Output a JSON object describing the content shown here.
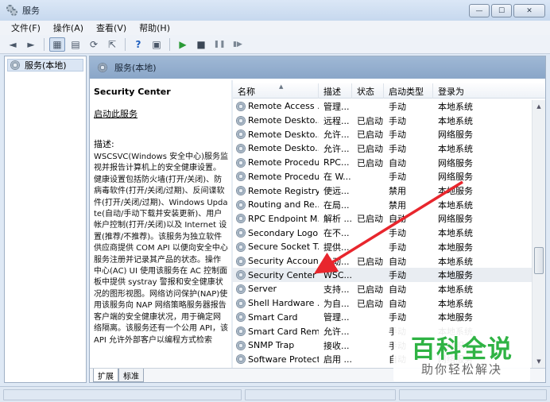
{
  "window": {
    "title": "服务",
    "controls": [
      "—",
      "☐",
      "✕"
    ]
  },
  "menu": [
    "文件(F)",
    "操作(A)",
    "查看(V)",
    "帮助(H)"
  ],
  "toolbar": [
    "◄",
    "►",
    "▦",
    "▤",
    "⟳",
    "⇱",
    "?",
    "▣",
    "▶",
    "■",
    "❚❚",
    "▮▶"
  ],
  "tree": {
    "item": "服务(本地)"
  },
  "header": {
    "title": "服务(本地)"
  },
  "description": {
    "title": "Security Center",
    "start_link": "启动此服务",
    "label": "描述:",
    "body": "WSCSVC(Windows 安全中心)服务监视并报告计算机上的安全健康设置。健康设置包括防火墙(打开/关闭)、防病毒软件(打开/关闭/过期)、反间谍软件(打开/关闭/过期)、Windows Update(自动/手动下载并安装更新)、用户帐户控制(打开/关闭)以及 Internet 设置(推荐/不推荐)。该服务为独立软件供应商提供 COM API 以便向安全中心服务注册并记录其产品的状态。操作中心(AC) UI 使用该服务在 AC 控制面板中提供 systray 警报和安全健康状况的图形视图。网络访问保护(NAP)使用该服务向 NAP 网络策略服务器报告客户端的安全健康状况，用于确定网络隔离。该服务还有一个公用 API，该 API 允许外部客户以编程方式检索"
  },
  "columns": [
    "名称",
    "描述",
    "状态",
    "启动类型",
    "登录为"
  ],
  "rows": [
    [
      "Remote Access ...",
      "管理...",
      "",
      "手动",
      "本地系统"
    ],
    [
      "Remote Deskto...",
      "远程...",
      "已启动",
      "手动",
      "本地系统"
    ],
    [
      "Remote Deskto...",
      "允许...",
      "已启动",
      "手动",
      "网络服务"
    ],
    [
      "Remote Deskto...",
      "允许...",
      "已启动",
      "手动",
      "本地系统"
    ],
    [
      "Remote Procedu...",
      "RPC...",
      "已启动",
      "自动",
      "网络服务"
    ],
    [
      "Remote Procedu...",
      "在 W...",
      "",
      "手动",
      "网络服务"
    ],
    [
      "Remote Registry",
      "使远...",
      "",
      "禁用",
      "本地服务"
    ],
    [
      "Routing and Re...",
      "在局...",
      "",
      "禁用",
      "本地系统"
    ],
    [
      "RPC Endpoint M...",
      "解析 ...",
      "已启动",
      "自动",
      "网络服务"
    ],
    [
      "Secondary Logon",
      "在不...",
      "",
      "手动",
      "本地系统"
    ],
    [
      "Secure Socket T...",
      "提供...",
      "",
      "手动",
      "本地服务"
    ],
    [
      "Security Account...",
      "启动...",
      "已启动",
      "自动",
      "本地系统"
    ],
    [
      "Security Center",
      "WSC...",
      "",
      "手动",
      "本地服务"
    ],
    [
      "Server",
      "支持...",
      "已启动",
      "自动",
      "本地系统"
    ],
    [
      "Shell Hardware ...",
      "为自...",
      "已启动",
      "自动",
      "本地系统"
    ],
    [
      "Smart Card",
      "管理...",
      "",
      "手动",
      "本地服务"
    ],
    [
      "Smart Card Rem...",
      "允许...",
      "",
      "手动",
      "本地系统"
    ],
    [
      "SNMP Trap",
      "接收...",
      "",
      "手动",
      "本地服务"
    ],
    [
      "Software Protect...",
      "启用 ...",
      "",
      "自动",
      "网络服务"
    ]
  ],
  "selected_row": 12,
  "tabs": [
    "扩展",
    "标准"
  ],
  "watermark": {
    "title": "百科全说",
    "subtitle": "助你轻松解决"
  },
  "colors": {
    "arrow": "#e8262d",
    "watermark_green": "#2fb344",
    "header_bg": "#95b1d2"
  }
}
